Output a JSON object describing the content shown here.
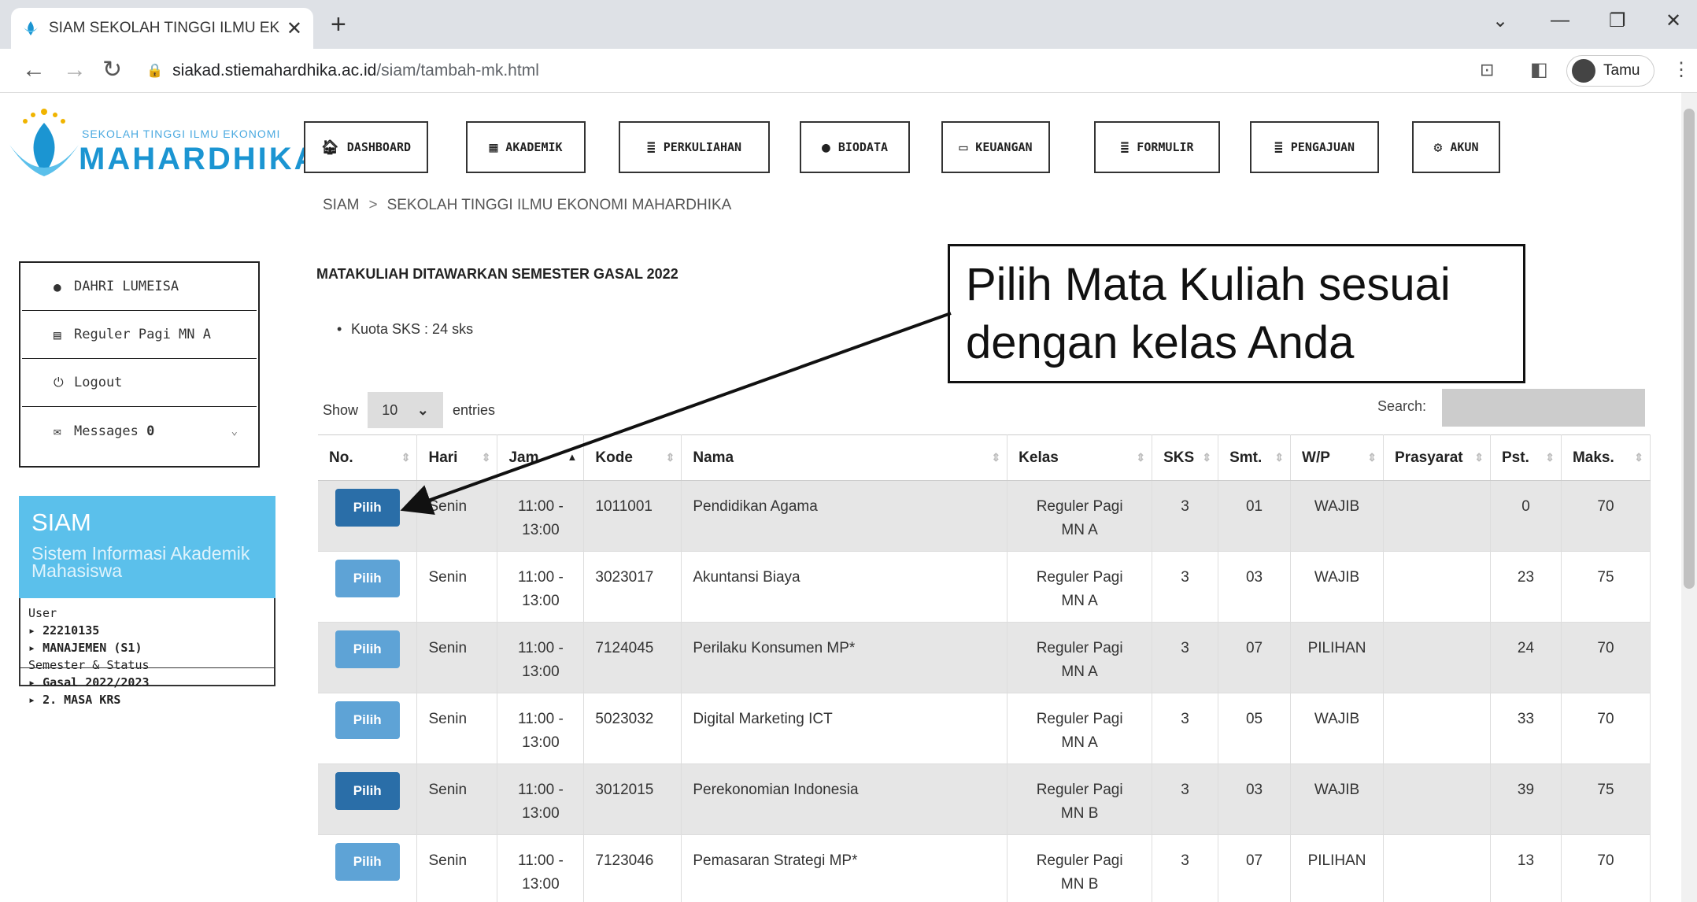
{
  "browser": {
    "tab_title": "SIAM SEKOLAH TINGGI ILMU EK●",
    "tab_close": "✕",
    "new_tab": "+",
    "url_host": "siakad.stiemahardhika.ac.id",
    "url_path": "/siam/tambah-mk.html",
    "profile_label": "Tamu"
  },
  "logo": {
    "sub": "SEKOLAH TINGGI ILMU EKONOMI",
    "name": "MAHARDHIKA"
  },
  "nav": [
    {
      "label": "DASHBOARD",
      "icon": "home-icon"
    },
    {
      "label": "AKADEMIK",
      "icon": "briefcase-icon"
    },
    {
      "label": "PERKULIAHAN",
      "icon": "book-icon"
    },
    {
      "label": "BIODATA",
      "icon": "user-icon"
    },
    {
      "label": "KEUANGAN",
      "icon": "money-icon"
    },
    {
      "label": "FORMULIR",
      "icon": "form-icon"
    },
    {
      "label": "PENGAJUAN",
      "icon": "form-icon"
    },
    {
      "label": "AKUN",
      "icon": "gears-icon"
    }
  ],
  "breadcrumb": {
    "root": "SIAM",
    "sep": ">",
    "current": "SEKOLAH TINGGI ILMU EKONOMI MAHARDHIKA"
  },
  "userbox": {
    "name": "DAHRI LUMEISA",
    "class": "Reguler Pagi MN A",
    "logout": "Logout",
    "messages_label": "Messages",
    "messages_count": "0"
  },
  "siam": {
    "title": "SIAM",
    "subtitle": "Sistem Informasi Akademik Mahasiswa",
    "user_label": "User",
    "user_id": "22210135",
    "program": "MANAJEMEN (S1)",
    "sem_label": "Semester & Status",
    "semester": "Gasal 2022/2023",
    "status": "2. MASA KRS"
  },
  "main": {
    "heading": "MATAKULIAH DITAWARKAN SEMESTER GASAL 2022",
    "kuota": "Kuota SKS : 24 sks",
    "show": "Show",
    "entries_value": "10",
    "entries": "entries",
    "search_label": "Search:"
  },
  "table": {
    "headers": [
      "No.",
      "Hari",
      "Jam",
      "Kode",
      "Nama",
      "Kelas",
      "SKS",
      "Smt.",
      "W/P",
      "Prasyarat",
      "Pst.",
      "Maks."
    ],
    "rows": [
      {
        "btn": "Pilih",
        "active": true,
        "hari": "Senin",
        "jam1": "11:00 -",
        "jam2": "13:00",
        "kode": "1011001",
        "nama": "Pendidikan Agama",
        "kelas1": "Reguler Pagi",
        "kelas2": "MN A",
        "sks": "3",
        "smt": "01",
        "wp": "WAJIB",
        "prasyarat": "",
        "pst": "0",
        "maks": "70"
      },
      {
        "btn": "Pilih",
        "active": false,
        "hari": "Senin",
        "jam1": "11:00 -",
        "jam2": "13:00",
        "kode": "3023017",
        "nama": "Akuntansi Biaya",
        "kelas1": "Reguler Pagi",
        "kelas2": "MN A",
        "sks": "3",
        "smt": "03",
        "wp": "WAJIB",
        "prasyarat": "",
        "pst": "23",
        "maks": "75"
      },
      {
        "btn": "Pilih",
        "active": false,
        "hari": "Senin",
        "jam1": "11:00 -",
        "jam2": "13:00",
        "kode": "7124045",
        "nama": "Perilaku Konsumen MP*",
        "kelas1": "Reguler Pagi",
        "kelas2": "MN A",
        "sks": "3",
        "smt": "07",
        "wp": "PILIHAN",
        "prasyarat": "",
        "pst": "24",
        "maks": "70"
      },
      {
        "btn": "Pilih",
        "active": false,
        "hari": "Senin",
        "jam1": "11:00 -",
        "jam2": "13:00",
        "kode": "5023032",
        "nama": "Digital Marketing ICT",
        "kelas1": "Reguler Pagi",
        "kelas2": "MN A",
        "sks": "3",
        "smt": "05",
        "wp": "WAJIB",
        "prasyarat": "",
        "pst": "33",
        "maks": "70"
      },
      {
        "btn": "Pilih",
        "active": true,
        "hari": "Senin",
        "jam1": "11:00 -",
        "jam2": "13:00",
        "kode": "3012015",
        "nama": "Perekonomian Indonesia",
        "kelas1": "Reguler Pagi",
        "kelas2": "MN B",
        "sks": "3",
        "smt": "03",
        "wp": "WAJIB",
        "prasyarat": "",
        "pst": "39",
        "maks": "75"
      },
      {
        "btn": "Pilih",
        "active": false,
        "hari": "Senin",
        "jam1": "11:00 -",
        "jam2": "13:00",
        "kode": "7123046",
        "nama": "Pemasaran Strategi MP*",
        "kelas1": "Reguler Pagi",
        "kelas2": "MN B",
        "sks": "3",
        "smt": "07",
        "wp": "PILIHAN",
        "prasyarat": "",
        "pst": "13",
        "maks": "70"
      }
    ]
  },
  "callout": {
    "line1": "Pilih Mata Kuliah sesuai",
    "line2": "dengan kelas Anda"
  },
  "colors": {
    "btn_active": "#2a6ea8",
    "btn_faded": "#5ea3d6",
    "accent": "#5bc0eb"
  }
}
